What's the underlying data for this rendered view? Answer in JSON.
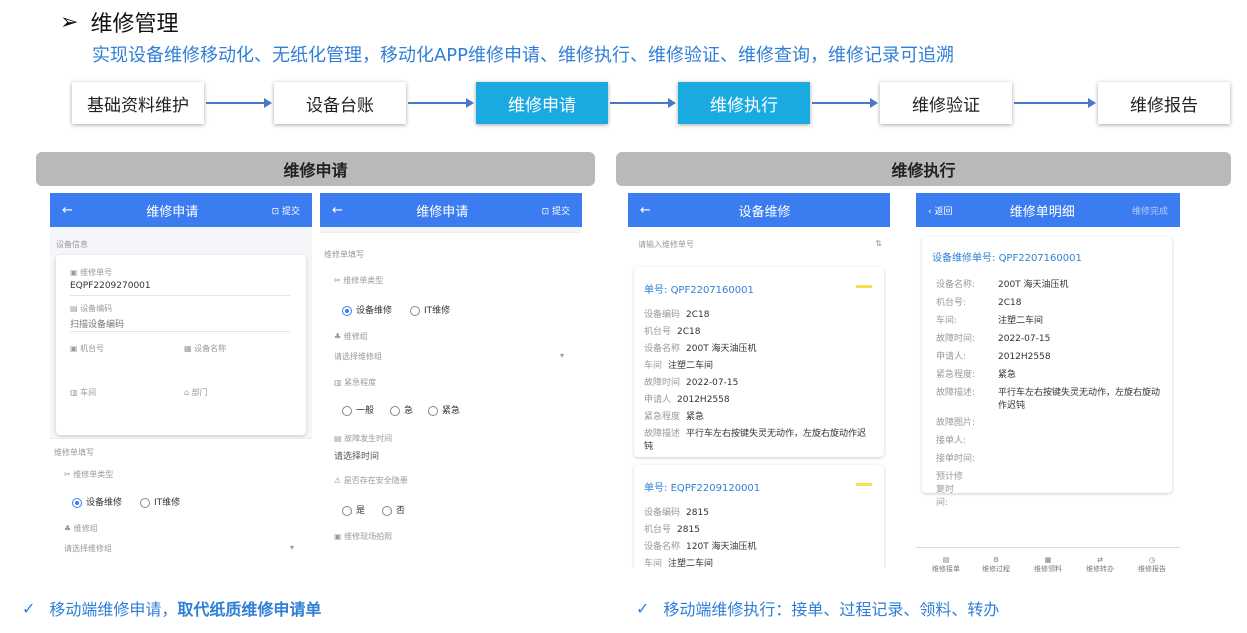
{
  "header": {
    "title": "维修管理",
    "subtitle": "实现设备维修移动化、无纸化管理，移动化APP维修申请、维修执行、维修验证、维修查询，维修记录可追溯"
  },
  "flow": [
    "基础资料维护",
    "设备台账",
    "维修申请",
    "维修执行",
    "维修验证",
    "维修报告"
  ],
  "sections": {
    "left": "维修申请",
    "right": "维修执行"
  },
  "p1": {
    "title": "维修申请",
    "submit": "提交",
    "dev_info": "设备信息",
    "order_no_label": "维修单号",
    "order_no": "EQPF2209270001",
    "dev_code_label": "设备编码",
    "dev_code_ph": "扫描设备编码",
    "machine_label": "机台号",
    "dev_name_label": "设备名称",
    "workshop_label": "车间",
    "dept_label": "部门",
    "fill": "维修单填写",
    "type_label": "维修单类型",
    "opt1": "设备维修",
    "opt2": "IT维修",
    "group_label": "维修组",
    "group_ph": "请选择维修组"
  },
  "p2": {
    "title": "维修申请",
    "submit": "提交",
    "fill": "维修单填写",
    "type_label": "维修单类型",
    "opt1": "设备维修",
    "opt2": "IT维修",
    "group_label": "维修组",
    "group_ph": "请选择维修组",
    "urgency_label": "紧急程度",
    "u1": "一般",
    "u2": "急",
    "u3": "紧急",
    "time_label": "故障发生时间",
    "time_ph": "请选择时间",
    "hazard_label": "是否存在安全隐患",
    "h1": "是",
    "h2": "否",
    "photo_label": "维修现场拍照"
  },
  "p3": {
    "title": "设备维修",
    "search_ph": "请输入维修单号",
    "c1": {
      "no_label": "单号:",
      "no": "QPF2207160001",
      "code_k": "设备编码",
      "code": "2C18",
      "machine_k": "机台号",
      "machine": "2C18",
      "name_k": "设备名称",
      "name": "200T 海天油压机",
      "ws_k": "车间",
      "ws": "注塑二车间",
      "time_k": "故障时间",
      "time": "2022-07-15",
      "app_k": "申请人",
      "app": "2012H2558",
      "urg_k": "紧急程度",
      "urg": "紧急",
      "desc_k": "故障描述",
      "desc": "平行车左右按键失灵无动作，左旋右旋动作迟钝"
    },
    "c2": {
      "no_label": "单号:",
      "no": "EQPF2209120001",
      "code_k": "设备编码",
      "code": "2815",
      "machine_k": "机台号",
      "machine": "2815",
      "name_k": "设备名称",
      "name": "120T 海天油压机",
      "ws_k": "车间",
      "ws": "注塑二车间"
    }
  },
  "p4": {
    "back": "返回",
    "title": "维修单明细",
    "action": "维修完成",
    "no_label": "设备维修单号:",
    "no": "QPF2207160001",
    "name_k": "设备名称:",
    "name": "200T 海天油压机",
    "machine_k": "机台号:",
    "machine": "2C18",
    "ws_k": "车间:",
    "ws": "注塑二车间",
    "time_k": "故障时间:",
    "time": "2022-07-15",
    "app_k": "申请人:",
    "app": "2012H2558",
    "urg_k": "紧急程度:",
    "urg": "紧急",
    "desc_k": "故障描述:",
    "desc": "平行车左右按键失灵无动作，左旋右旋动作迟钝",
    "img_k": "故障图片:",
    "rcv_k": "接单人:",
    "rcvt_k": "接单时间:",
    "est_k": "预计修复时间:",
    "nav": [
      "维修接单",
      "维修过程",
      "维修领料",
      "维修转办",
      "维修报告"
    ]
  },
  "notes": {
    "left_a": "移动端维修申请，",
    "left_b": "取代纸质维修申请单",
    "right": "移动端维修执行：接单、过程记录、领料、转办"
  }
}
